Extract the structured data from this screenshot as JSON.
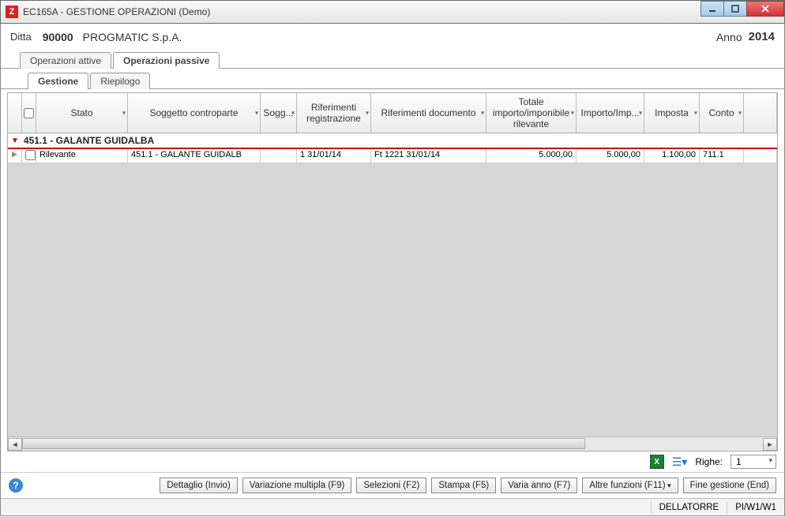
{
  "window": {
    "title": "EC165A - GESTIONE OPERAZIONI  (Demo)"
  },
  "header": {
    "ditta_label": "Ditta",
    "ditta_code": "90000",
    "company": "PROGMATIC S.p.A.",
    "anno_label": "Anno",
    "anno": "2014"
  },
  "tabs_main": [
    {
      "label": "Operazioni attive",
      "active": false
    },
    {
      "label": "Operazioni passive",
      "active": true
    }
  ],
  "tabs_sub": [
    {
      "label": "Gestione",
      "active": true
    },
    {
      "label": "Riepilogo",
      "active": false
    }
  ],
  "columns": {
    "stato": "Stato",
    "soggetto": "Soggetto controparte",
    "sogg2": "Sogg...",
    "rif_reg": "Riferimenti registrazione",
    "rif_doc": "Riferimenti documento",
    "totale": "Totale importo/imponibile rilevante",
    "impimp": "Importo/Imp...",
    "imposta": "Imposta",
    "conto": "Conto"
  },
  "group": {
    "title": "451.1 - GALANTE GUIDALBA"
  },
  "row": {
    "stato": "Rilevante",
    "soggetto": "451.1 - GALANTE GUIDALB",
    "sogg2": "",
    "rif_reg": "1 31/01/14",
    "rif_doc": "Ft 1221 31/01/14",
    "totale": "5.000,00",
    "impimp": "5.000,00",
    "imposta": "1.100,00",
    "conto": "711.1"
  },
  "footer_grid": {
    "righe_label": "Righe:",
    "righe_value": "1"
  },
  "buttons": {
    "dettaglio": "Dettaglio (Invio)",
    "variazione": "Variazione multipla (F9)",
    "selezioni": "Selezioni (F2)",
    "stampa": "Stampa (F5)",
    "varia_anno": "Varia anno (F7)",
    "altre": "Altre funzioni (F11)",
    "fine": "Fine gestione (End)"
  },
  "status": {
    "user": "DELLATORRE",
    "path": "PI/W1/W1"
  }
}
